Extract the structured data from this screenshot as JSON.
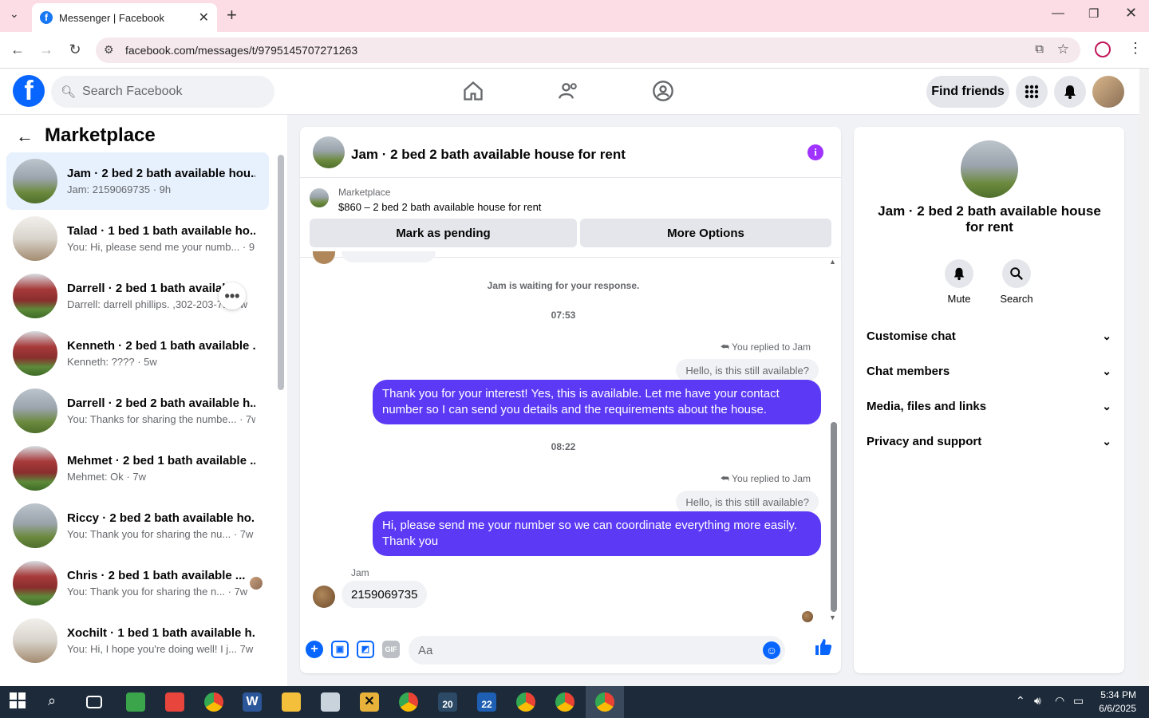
{
  "browser": {
    "tab_title": "Messenger | Facebook",
    "url": "facebook.com/messages/t/9795145707271263",
    "tab_close": "✕",
    "new_tab": "+"
  },
  "header": {
    "search_placeholder": "Search Facebook",
    "find_friends": "Find friends"
  },
  "sidebar": {
    "title": "Marketplace",
    "conversations": [
      {
        "title": "Jam · 2 bed 2 bath available hou...",
        "preview": "Jam: 2159069735 · 9h",
        "thumb": "grey"
      },
      {
        "title": "Talad · 1 bed 1 bath available ho...",
        "preview": "You: Hi, please send me your numb... · 9h",
        "thumb": "room"
      },
      {
        "title": "Darrell · 2 bed 1 bath availab...",
        "preview": "Darrell: darrell phillips. ,302-203-7... 5w",
        "thumb": "red"
      },
      {
        "title": "Kenneth · 2 bed 1 bath available ...",
        "preview": "Kenneth: ???? · 5w",
        "thumb": "red"
      },
      {
        "title": "Darrell · 2 bed 2 bath available h...",
        "preview": "You: Thanks for sharing the numbe... · 7w",
        "thumb": "grey"
      },
      {
        "title": "Mehmet · 2 bed 1 bath available ...",
        "preview": "Mehmet: Ok · 7w",
        "thumb": "red"
      },
      {
        "title": "Riccy · 2 bed 2 bath available ho...",
        "preview": "You: Thank you for sharing the nu...  · 7w",
        "thumb": "grey"
      },
      {
        "title": "Chris · 2 bed 1 bath available ...",
        "preview": "You: Thank you for sharing the n... · 7w",
        "thumb": "red"
      },
      {
        "title": "Xochilt · 1 bed 1 bath available h...",
        "preview": "You: Hi, I hope you're doing well! I j... 7w",
        "thumb": "room"
      }
    ]
  },
  "chat": {
    "title": "Jam · 2 bed 2 bath available house for rent",
    "marketplace_label": "Marketplace",
    "listing": "$860 – 2 bed 2 bath available house for rent",
    "mark_pending": "Mark as pending",
    "more_options": "More Options",
    "waiting_note": "Jam is waiting for your response.",
    "time1": "07:53",
    "time2": "08:22",
    "replied_label": "You replied to Jam",
    "quoted_text": "Hello, is this still available?",
    "message1": "Thank you for your interest! Yes, this is available. Let me have your contact number so I can send you details and the requirements about the house.",
    "message2": "Hi, please send me your number so we can coordinate everything more easily. Thank you",
    "sender_name": "Jam",
    "received_message": "2159069735",
    "composer_placeholder": "Aa",
    "gif_label": "GIF"
  },
  "details": {
    "title": "Jam · 2 bed 2 bath available house for rent",
    "mute": "Mute",
    "search": "Search",
    "rows": [
      "Customise chat",
      "Chat members",
      "Media, files and links",
      "Privacy and support"
    ]
  },
  "taskbar": {
    "time": "5:34 PM",
    "date": "6/6/2025",
    "badge1": "20",
    "badge2": "22"
  },
  "colors": {
    "fb_blue": "#0866ff",
    "bubble_purple": "#5b39f5",
    "active_conv": "#e7f1fd",
    "tab_bg": "#fcdde6"
  }
}
